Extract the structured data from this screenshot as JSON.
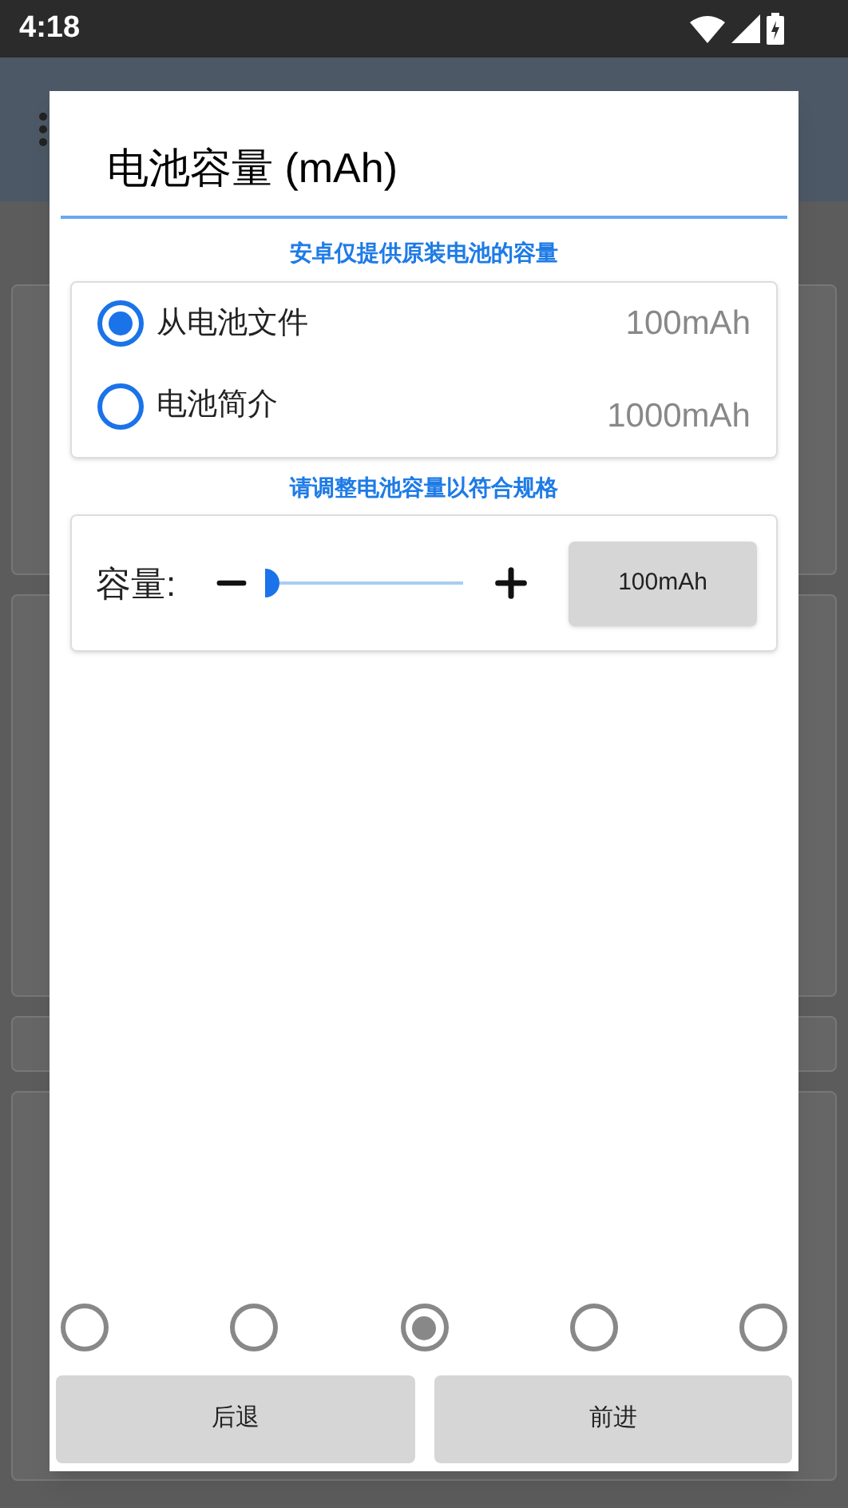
{
  "status_bar": {
    "time": "4:18"
  },
  "dialog": {
    "title": "电池容量 (mAh)",
    "source_note": "安卓仅提供原装电池的容量",
    "sources": [
      {
        "label": "从电池文件",
        "value": "100mAh",
        "selected": true
      },
      {
        "label": "电池简介",
        "value": "1000mAh",
        "selected": false
      }
    ],
    "adjust_note": "请调整电池容量以符合规格",
    "capacity": {
      "label": "容量:",
      "level": 0,
      "value": "100mAh"
    },
    "steps": [
      {
        "selected": false
      },
      {
        "selected": false
      },
      {
        "selected": true
      },
      {
        "selected": false
      },
      {
        "selected": false
      }
    ],
    "buttons": [
      "后退",
      "前进"
    ]
  }
}
